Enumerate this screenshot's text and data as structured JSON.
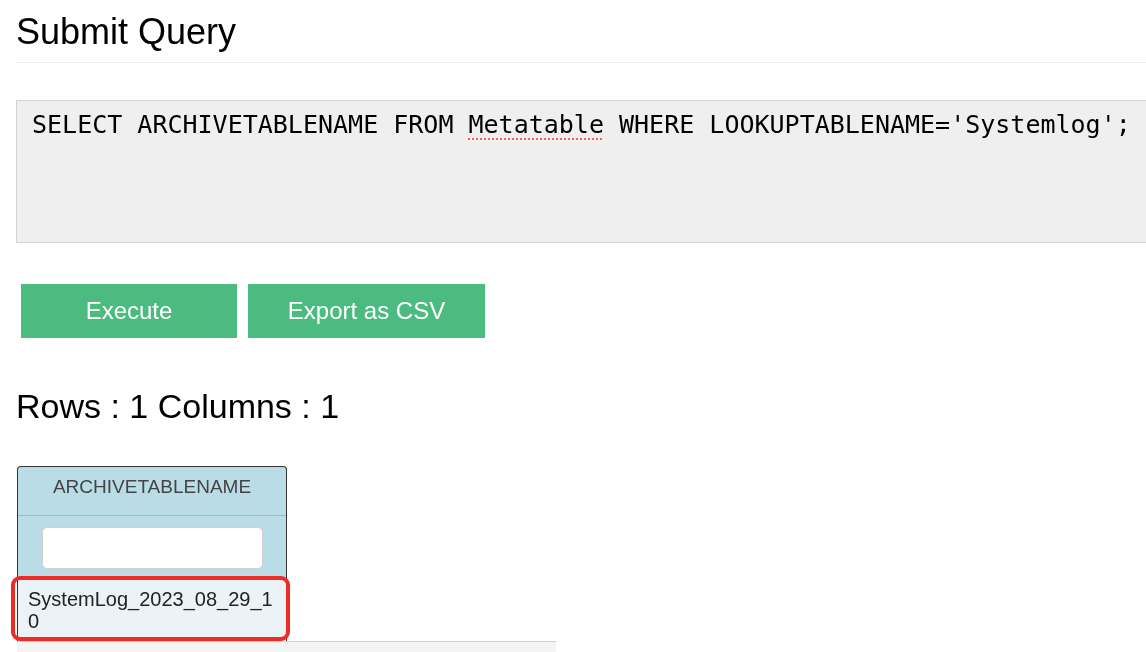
{
  "page_title": "Submit Query",
  "query_editor": {
    "segments": [
      {
        "text": "SELECT ARCHIVETABLENAME FROM ",
        "spelling_flagged": false
      },
      {
        "text": "Metatable",
        "spelling_flagged": true
      },
      {
        "text": " WHERE LOOKUPTABLENAME='Systemlog';",
        "spelling_flagged": false
      }
    ]
  },
  "buttons": [
    {
      "label": "Execute"
    },
    {
      "label": "Export as CSV"
    }
  ],
  "result_summary": "Rows : 1 Columns : 1",
  "table": {
    "columns": [
      {
        "label": "ARCHIVETABLENAME",
        "filterable": true
      }
    ],
    "rows": [
      {
        "cells": [
          "SystemLog_2023_08_29_10"
        ],
        "highlighted": true
      }
    ]
  }
}
